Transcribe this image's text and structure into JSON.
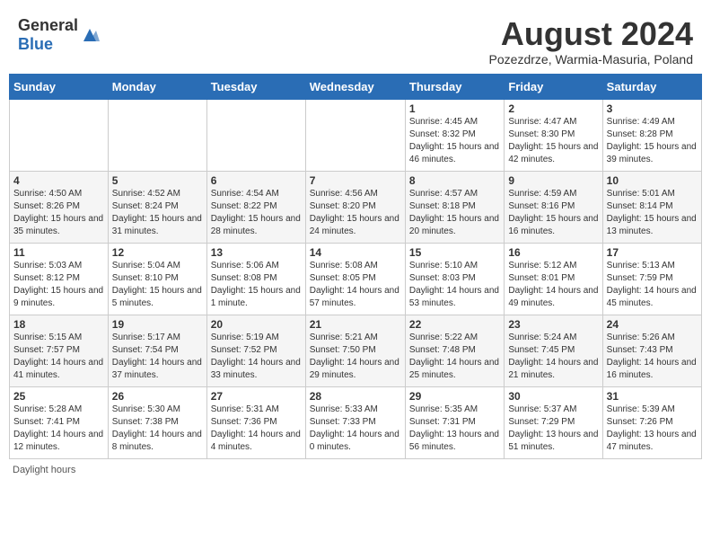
{
  "header": {
    "logo_general": "General",
    "logo_blue": "Blue",
    "month_year": "August 2024",
    "location": "Pozezdrze, Warmia-Masuria, Poland"
  },
  "calendar": {
    "days_of_week": [
      "Sunday",
      "Monday",
      "Tuesday",
      "Wednesday",
      "Thursday",
      "Friday",
      "Saturday"
    ],
    "weeks": [
      [
        {
          "day": "",
          "info": ""
        },
        {
          "day": "",
          "info": ""
        },
        {
          "day": "",
          "info": ""
        },
        {
          "day": "",
          "info": ""
        },
        {
          "day": "1",
          "info": "Sunrise: 4:45 AM\nSunset: 8:32 PM\nDaylight: 15 hours and 46 minutes."
        },
        {
          "day": "2",
          "info": "Sunrise: 4:47 AM\nSunset: 8:30 PM\nDaylight: 15 hours and 42 minutes."
        },
        {
          "day": "3",
          "info": "Sunrise: 4:49 AM\nSunset: 8:28 PM\nDaylight: 15 hours and 39 minutes."
        }
      ],
      [
        {
          "day": "4",
          "info": "Sunrise: 4:50 AM\nSunset: 8:26 PM\nDaylight: 15 hours and 35 minutes."
        },
        {
          "day": "5",
          "info": "Sunrise: 4:52 AM\nSunset: 8:24 PM\nDaylight: 15 hours and 31 minutes."
        },
        {
          "day": "6",
          "info": "Sunrise: 4:54 AM\nSunset: 8:22 PM\nDaylight: 15 hours and 28 minutes."
        },
        {
          "day": "7",
          "info": "Sunrise: 4:56 AM\nSunset: 8:20 PM\nDaylight: 15 hours and 24 minutes."
        },
        {
          "day": "8",
          "info": "Sunrise: 4:57 AM\nSunset: 8:18 PM\nDaylight: 15 hours and 20 minutes."
        },
        {
          "day": "9",
          "info": "Sunrise: 4:59 AM\nSunset: 8:16 PM\nDaylight: 15 hours and 16 minutes."
        },
        {
          "day": "10",
          "info": "Sunrise: 5:01 AM\nSunset: 8:14 PM\nDaylight: 15 hours and 13 minutes."
        }
      ],
      [
        {
          "day": "11",
          "info": "Sunrise: 5:03 AM\nSunset: 8:12 PM\nDaylight: 15 hours and 9 minutes."
        },
        {
          "day": "12",
          "info": "Sunrise: 5:04 AM\nSunset: 8:10 PM\nDaylight: 15 hours and 5 minutes."
        },
        {
          "day": "13",
          "info": "Sunrise: 5:06 AM\nSunset: 8:08 PM\nDaylight: 15 hours and 1 minute."
        },
        {
          "day": "14",
          "info": "Sunrise: 5:08 AM\nSunset: 8:05 PM\nDaylight: 14 hours and 57 minutes."
        },
        {
          "day": "15",
          "info": "Sunrise: 5:10 AM\nSunset: 8:03 PM\nDaylight: 14 hours and 53 minutes."
        },
        {
          "day": "16",
          "info": "Sunrise: 5:12 AM\nSunset: 8:01 PM\nDaylight: 14 hours and 49 minutes."
        },
        {
          "day": "17",
          "info": "Sunrise: 5:13 AM\nSunset: 7:59 PM\nDaylight: 14 hours and 45 minutes."
        }
      ],
      [
        {
          "day": "18",
          "info": "Sunrise: 5:15 AM\nSunset: 7:57 PM\nDaylight: 14 hours and 41 minutes."
        },
        {
          "day": "19",
          "info": "Sunrise: 5:17 AM\nSunset: 7:54 PM\nDaylight: 14 hours and 37 minutes."
        },
        {
          "day": "20",
          "info": "Sunrise: 5:19 AM\nSunset: 7:52 PM\nDaylight: 14 hours and 33 minutes."
        },
        {
          "day": "21",
          "info": "Sunrise: 5:21 AM\nSunset: 7:50 PM\nDaylight: 14 hours and 29 minutes."
        },
        {
          "day": "22",
          "info": "Sunrise: 5:22 AM\nSunset: 7:48 PM\nDaylight: 14 hours and 25 minutes."
        },
        {
          "day": "23",
          "info": "Sunrise: 5:24 AM\nSunset: 7:45 PM\nDaylight: 14 hours and 21 minutes."
        },
        {
          "day": "24",
          "info": "Sunrise: 5:26 AM\nSunset: 7:43 PM\nDaylight: 14 hours and 16 minutes."
        }
      ],
      [
        {
          "day": "25",
          "info": "Sunrise: 5:28 AM\nSunset: 7:41 PM\nDaylight: 14 hours and 12 minutes."
        },
        {
          "day": "26",
          "info": "Sunrise: 5:30 AM\nSunset: 7:38 PM\nDaylight: 14 hours and 8 minutes."
        },
        {
          "day": "27",
          "info": "Sunrise: 5:31 AM\nSunset: 7:36 PM\nDaylight: 14 hours and 4 minutes."
        },
        {
          "day": "28",
          "info": "Sunrise: 5:33 AM\nSunset: 7:33 PM\nDaylight: 14 hours and 0 minutes."
        },
        {
          "day": "29",
          "info": "Sunrise: 5:35 AM\nSunset: 7:31 PM\nDaylight: 13 hours and 56 minutes."
        },
        {
          "day": "30",
          "info": "Sunrise: 5:37 AM\nSunset: 7:29 PM\nDaylight: 13 hours and 51 minutes."
        },
        {
          "day": "31",
          "info": "Sunrise: 5:39 AM\nSunset: 7:26 PM\nDaylight: 13 hours and 47 minutes."
        }
      ]
    ]
  },
  "footer": {
    "daylight_hours": "Daylight hours"
  }
}
